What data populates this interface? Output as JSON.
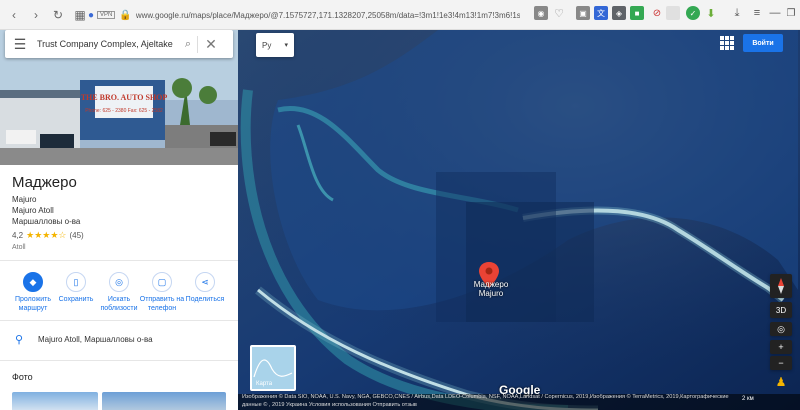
{
  "browser": {
    "url": "www.google.ru/maps/place/Маджеро/@7.1575727,171.1328207,25058m/data=!3m1!1e3!4m13!1m7!3m6!1s0x65",
    "vpn_label": "VPN"
  },
  "search": {
    "value": "Trust Company Complex, Ajeltake"
  },
  "layer_select": {
    "value": "Рy"
  },
  "signin_label": "Войти",
  "hero": {
    "sign_text": "THE BRO. AUTO SHOP",
    "sign_phone": "Phone: 625 - 2380  Fax: 625 - 2582"
  },
  "place": {
    "title": "Маджеро",
    "name_en": "Majuro",
    "atoll": "Majuro Atoll",
    "country": "Маршалловы о-ва",
    "rating": "4,2",
    "stars": "★★★★☆",
    "reviews": "(45)",
    "category": "Atoll",
    "address": "Majuro Atoll, Маршалловы о-ва"
  },
  "actions": [
    {
      "label": "Проложить маршрут",
      "icon": "directions-icon"
    },
    {
      "label": "Сохранить",
      "icon": "bookmark-icon"
    },
    {
      "label": "Искать поблизости",
      "icon": "nearby-icon"
    },
    {
      "label": "Отправить на телефон",
      "icon": "send-to-phone-icon"
    },
    {
      "label": "Поделиться",
      "icon": "share-icon"
    }
  ],
  "photos_title": "Фото",
  "map": {
    "marker_title": "Маджеро",
    "marker_subtitle": "Majuro",
    "minimap_label": "Карта",
    "google_logo": "Google",
    "attribution_line1": "Изображения © Data SIO, NOAA, U.S. Navy, NGA, GEBCO,CNES / Airbus,Data LDEO-Columbia, NSF, NOAA,Landsat / Copernicus, 2019,Изображения © TerraMetrics, 2019,Картографические",
    "attribution_line2": "данные © , 2019    Украина    Условия использования    Отправить отзыв",
    "scale": "2 км",
    "ctrl_3d": "3D",
    "ctrl_plus": "+",
    "ctrl_minus": "−"
  },
  "colors": {
    "accent": "#1a73e8",
    "marker": "#ea4335",
    "star": "#f4b400"
  }
}
